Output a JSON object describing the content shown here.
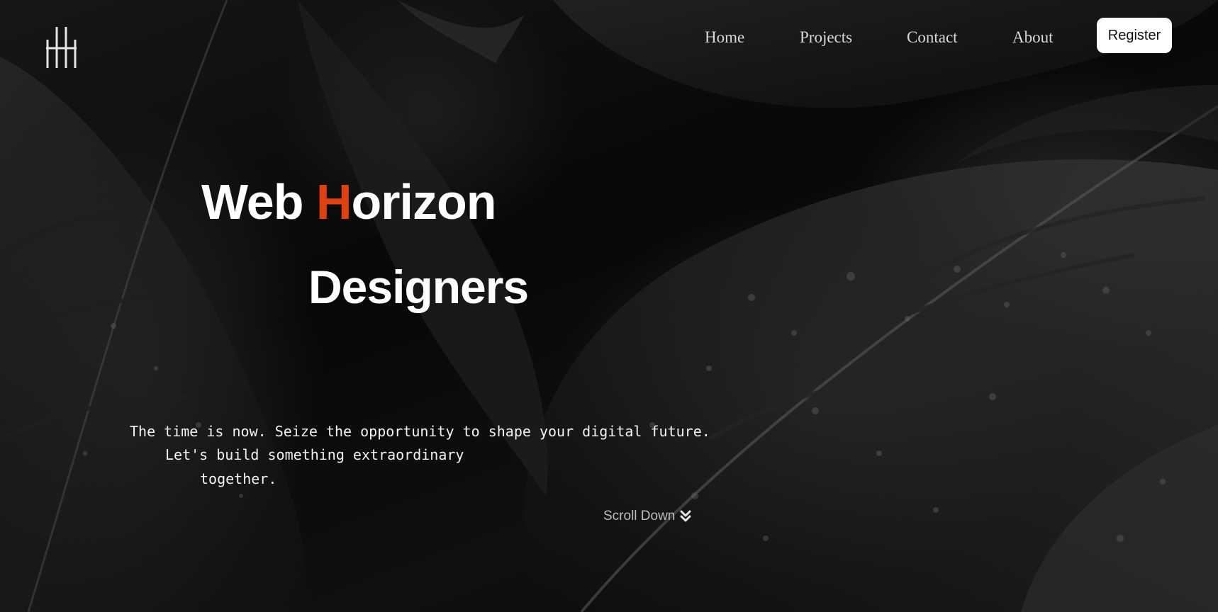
{
  "brand": {
    "logo_icon": "triple-bar-h-logo-icon"
  },
  "nav": {
    "items": [
      {
        "label": "Home"
      },
      {
        "label": "Projects"
      },
      {
        "label": "Contact"
      },
      {
        "label": "About"
      }
    ],
    "register_label": "Register"
  },
  "hero": {
    "title_before": "Web ",
    "title_accent": "H",
    "title_after": "orizon",
    "title_line2": "Designers",
    "accent_color": "#e0410e",
    "tagline": [
      "The time is now. Seize the opportunity to shape your digital future.",
      "Let's build something extraordinary",
      "together."
    ],
    "scroll_label": "Scroll Down",
    "scroll_icon": "double-chevron-down-icon"
  }
}
